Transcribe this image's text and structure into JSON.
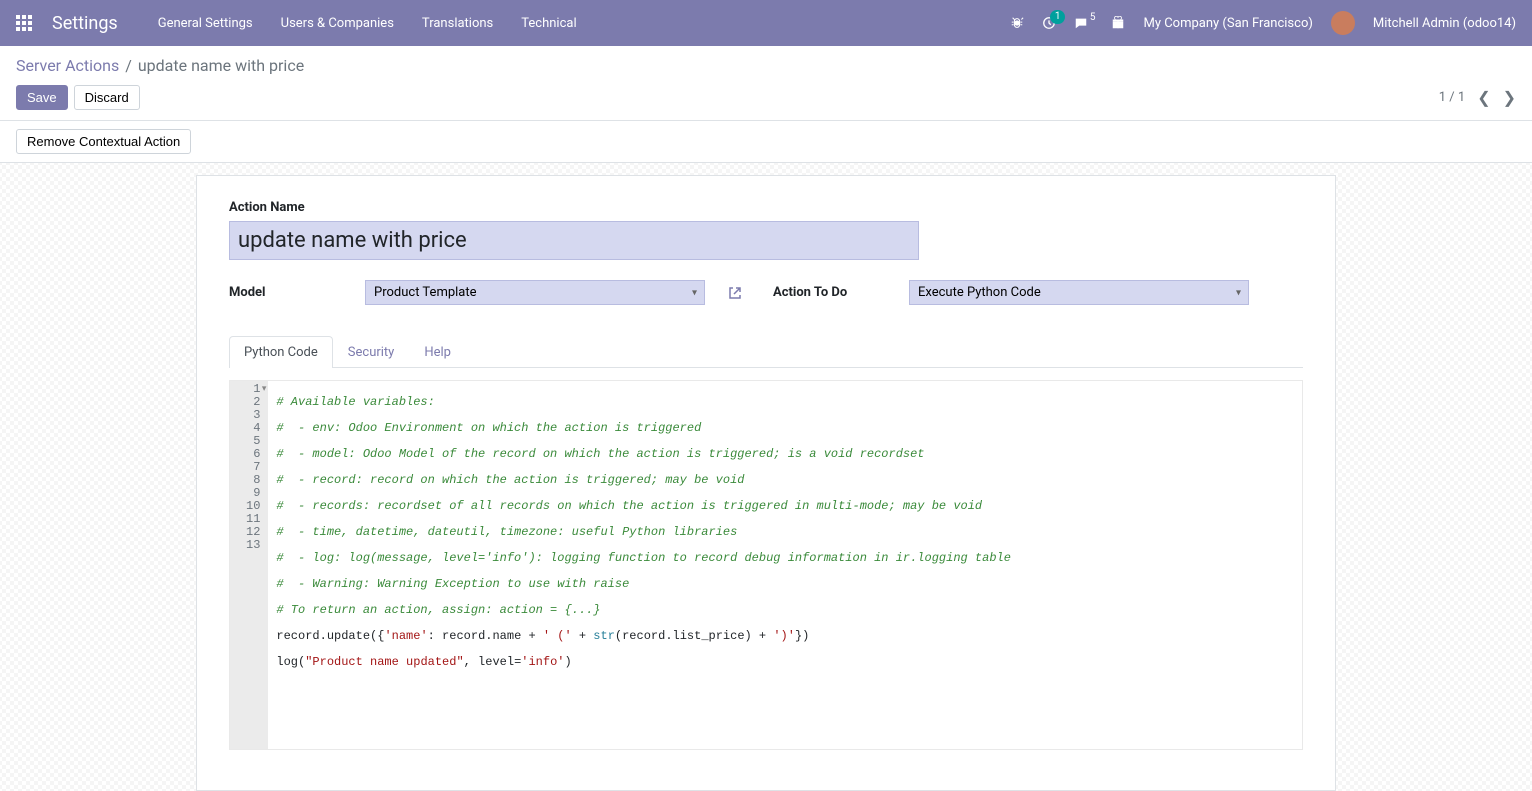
{
  "header": {
    "app_title": "Settings",
    "menu": [
      "General Settings",
      "Users & Companies",
      "Translations",
      "Technical"
    ],
    "badge1": "1",
    "badge2": "5",
    "company": "My Company (San Francisco)",
    "user": "Mitchell Admin (odoo14)"
  },
  "breadcrumb": {
    "root": "Server Actions",
    "current": "update name with price"
  },
  "buttons": {
    "save": "Save",
    "discard": "Discard",
    "remove_ctx": "Remove Contextual Action"
  },
  "pager": {
    "text": "1 / 1"
  },
  "form": {
    "action_name_label": "Action Name",
    "action_name_value": "update name with price",
    "model_label": "Model",
    "model_value": "Product Template",
    "action_todo_label": "Action To Do",
    "action_todo_value": "Execute Python Code"
  },
  "tabs": {
    "python": "Python Code",
    "security": "Security",
    "help": "Help"
  },
  "code": {
    "lines": [
      "# Available variables:",
      "#  - env: Odoo Environment on which the action is triggered",
      "#  - model: Odoo Model of the record on which the action is triggered; is a void recordset",
      "#  - record: record on which the action is triggered; may be void",
      "#  - records: recordset of all records on which the action is triggered in multi-mode; may be void",
      "#  - time, datetime, dateutil, timezone: useful Python libraries",
      "#  - log: log(message, level='info'): logging function to record debug information in ir.logging table",
      "#  - Warning: Warning Exception to use with raise",
      "# To return an action, assign: action = {...}",
      "record.update({'name': record.name + ' (' + str(record.list_price) + ')'})",
      "log(\"Product name updated\", level='info')",
      "",
      ""
    ]
  }
}
